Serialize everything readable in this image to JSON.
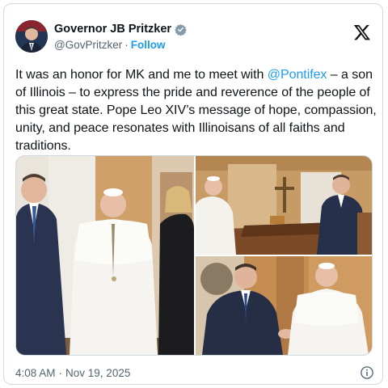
{
  "author": {
    "name": "Governor JB Pritzker",
    "handle": "@GovPritzker",
    "separator": "·",
    "follow_label": "Follow",
    "avatar_icon": "profile-photo",
    "verified_icon": "verified-badge-icon"
  },
  "post": {
    "text_part1": "It was an honor for MK and me to meet with ",
    "mention": "@Pontifex",
    "text_part2": " – a son of Illinois – to express the pride and reverence of the people of this great state. Pope Leo XIV’s message of hope, compassion, unity, and peace resonates with Illinoisans of all faiths and traditions."
  },
  "media": {
    "photos": [
      {
        "subject": "group-photo"
      },
      {
        "subject": "meeting-at-desk-photo"
      },
      {
        "subject": "handshake-photo"
      }
    ]
  },
  "meta": {
    "time": "4:08 AM",
    "separator": "·",
    "date": "Nov 19, 2025"
  },
  "colors": {
    "accent": "#1d9bf0",
    "text": "#0f1419",
    "secondary": "#536471",
    "border": "#cfd9de"
  }
}
